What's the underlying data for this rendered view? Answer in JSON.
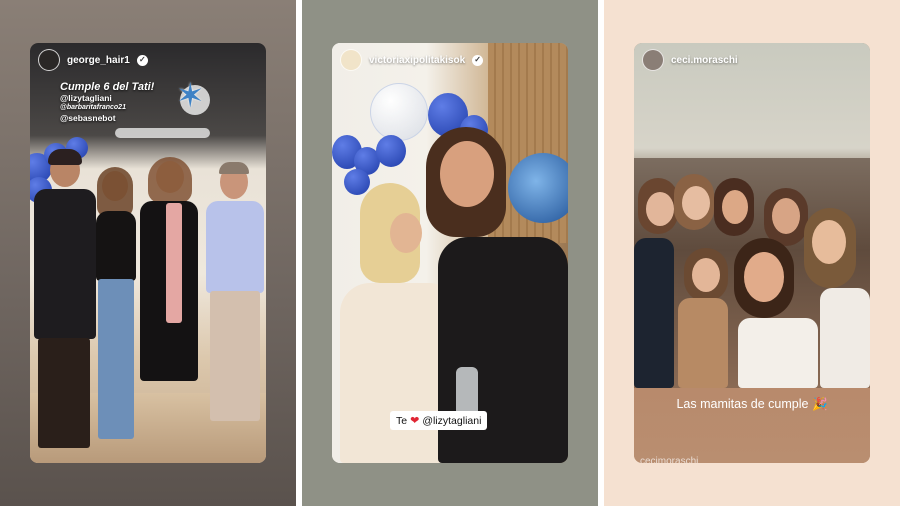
{
  "stories": [
    {
      "username": "george_hair1",
      "verified": true,
      "caption_title": "Cumple 6 del Tati!",
      "caption_tags": [
        "@lizytagliani",
        "@barbaritafranco21",
        "@sebasnebot"
      ]
    },
    {
      "username": "victoriaxipolitakisok",
      "verified": true,
      "caption": "Te",
      "caption_mention": "@lizytagliani"
    },
    {
      "username": "ceci.moraschi",
      "verified": false,
      "caption": "Las mamitas de cumple 🎉",
      "bottom_text": "cecimoraschi"
    }
  ],
  "colors": {
    "panel1_bg": "#7c726a",
    "panel2_bg": "#8f9186",
    "panel3_bg": "#f5e1d1",
    "balloon_blue": "#2846b0",
    "heart_red": "#e02533"
  },
  "icons": [
    "verified-badge-icon",
    "heart-icon",
    "party-popper-icon",
    "star-decoration-icon"
  ]
}
